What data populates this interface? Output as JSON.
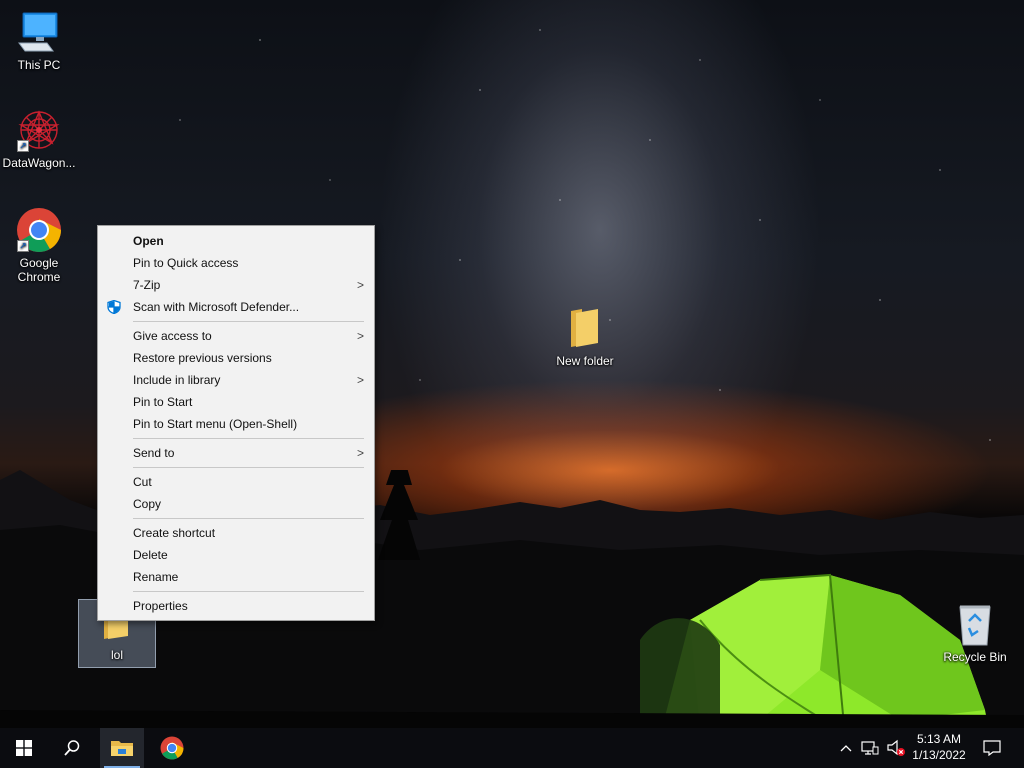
{
  "desktop": {
    "icons": {
      "this_pc": "This PC",
      "datawagon": "DataWagon...",
      "chrome_line1": "Google",
      "chrome_line2": "Chrome",
      "new_folder": "New folder",
      "lol": "lol",
      "recycle_bin": "Recycle Bin"
    }
  },
  "context_menu": {
    "open": "Open",
    "pin_quick_access": "Pin to Quick access",
    "seven_zip": "7-Zip",
    "scan_defender": "Scan with Microsoft Defender...",
    "give_access": "Give access to",
    "restore_versions": "Restore previous versions",
    "include_library": "Include in library",
    "pin_start": "Pin to Start",
    "pin_start_menu": "Pin to Start menu (Open-Shell)",
    "send_to": "Send to",
    "cut": "Cut",
    "copy": "Copy",
    "create_shortcut": "Create shortcut",
    "delete": "Delete",
    "rename": "Rename",
    "properties": "Properties",
    "submenu_arrow": ">"
  },
  "taskbar": {
    "time": "5:13 AM",
    "date": "1/13/2022"
  },
  "colors": {
    "folder_yellow": "#f4cf68",
    "accent_blue": "#0078d7",
    "menu_bg": "#f2f2f2",
    "taskbar_bg": "#0b0c10",
    "tent_green": "#8ee82a"
  }
}
